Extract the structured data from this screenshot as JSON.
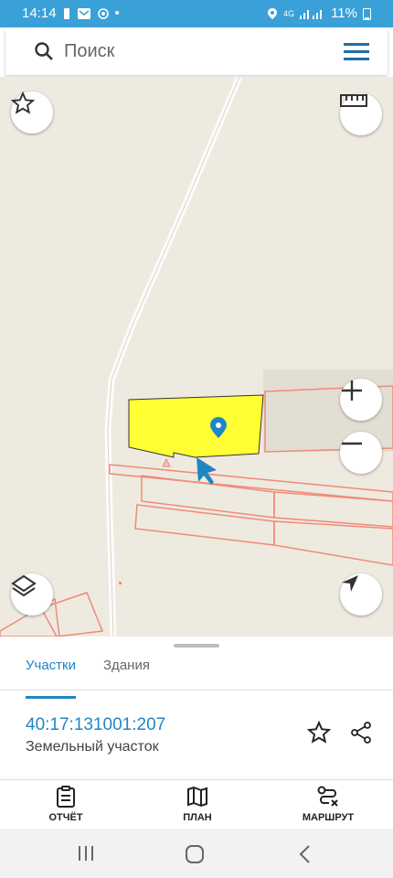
{
  "status": {
    "time": "14:14",
    "network": "4G",
    "battery": "11%"
  },
  "search": {
    "placeholder": "Поиск"
  },
  "panel": {
    "tabs": [
      {
        "label": "Участки",
        "active": true
      },
      {
        "label": "Здания",
        "active": false
      }
    ],
    "parcel": {
      "id": "40:17:131001:207",
      "type": "Земельный участок"
    }
  },
  "bottom_nav": [
    {
      "label": "ОТЧЁТ",
      "icon": "clipboard-icon"
    },
    {
      "label": "ПЛАН",
      "icon": "map-icon"
    },
    {
      "label": "МАРШРУТ",
      "icon": "route-icon"
    }
  ],
  "colors": {
    "accent": "#1f86c4",
    "highlight": "#ffff33",
    "parcel_outline": "#f08a78",
    "map_bg": "#eeeae0"
  }
}
